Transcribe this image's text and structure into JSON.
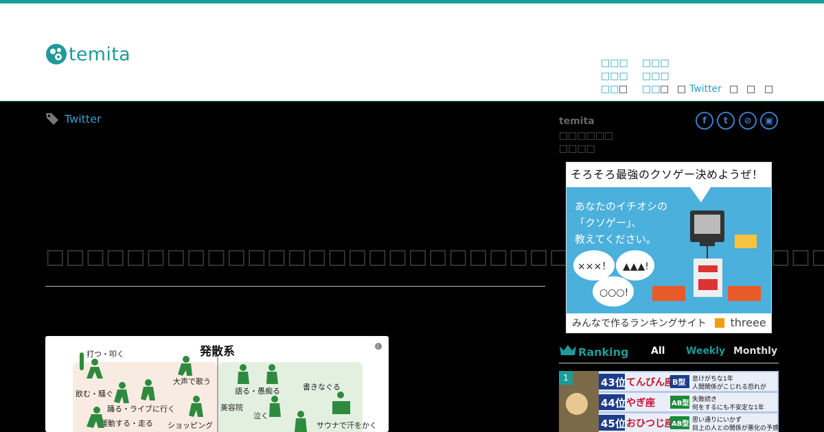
{
  "brand": {
    "name": "temita",
    "accent": "#1a9c98",
    "link_color": "#2ea0d6"
  },
  "nav": {
    "col1": [
      "□□□",
      "□□□",
      "□□"
    ],
    "col2": [
      "□□□",
      "□□□",
      "□□"
    ],
    "twitter": "Twitter",
    "glyph": "□"
  },
  "tag": {
    "label": "Twitter",
    "icon": "tag-icon"
  },
  "article": {
    "headline": "□□□□□□□□□□□□□□□□□□□□□□□□□□□□□□□□□□□□□□□",
    "image": {
      "title": "発散系",
      "info": "i",
      "labels": [
        "打つ・叩く",
        "飲む・騒ぐ",
        "大声で歌う",
        "踊る・ライブに行く",
        "運動する・走る",
        "ショッピング",
        "語る・愚痴る",
        "美容院",
        "泣く",
        "書きなぐる",
        "サウナで汗をかく"
      ]
    }
  },
  "sidebar": {
    "title": "temita",
    "desc_line1": "□□□□□□",
    "desc_line2": "□□□□",
    "social": [
      "facebook-icon",
      "twitter-icon",
      "link-icon",
      "bag-icon"
    ],
    "social_glyphs": [
      "f",
      "t",
      "⊘",
      "▣"
    ],
    "banner": {
      "top": "そろそろ最強のクソゲー決めようぜ！",
      "line1": "あなたのイチオシの",
      "line2": "「クソゲー」、",
      "line3": "教えてください。",
      "bubble1": "×××！",
      "bubble2": "▲▲▲!",
      "bubble3": "○○○!",
      "bottom": "みんなで作るランキングサイト",
      "brand": "threee"
    },
    "ranking": {
      "title": "Ranking",
      "tabs": [
        "All",
        "Weekly",
        "Monthly"
      ],
      "active_tab": "Weekly",
      "first_rank": "1",
      "rows": [
        {
          "rank": "43位",
          "sign": "てんびん座",
          "blood": "B型",
          "text1": "怠けがちな1年",
          "text2": "人間関係がこじれる恐れが"
        },
        {
          "rank": "44位",
          "sign": "やぎ座",
          "blood": "AB型",
          "text1": "失敗続き",
          "text2": "何をするにも不安定な1年"
        },
        {
          "rank": "45位",
          "sign": "おひつじ座",
          "blood": "AB型",
          "text1": "思い通りにいかず",
          "text2": "目上の人との関係が悪化の予感"
        }
      ]
    }
  }
}
